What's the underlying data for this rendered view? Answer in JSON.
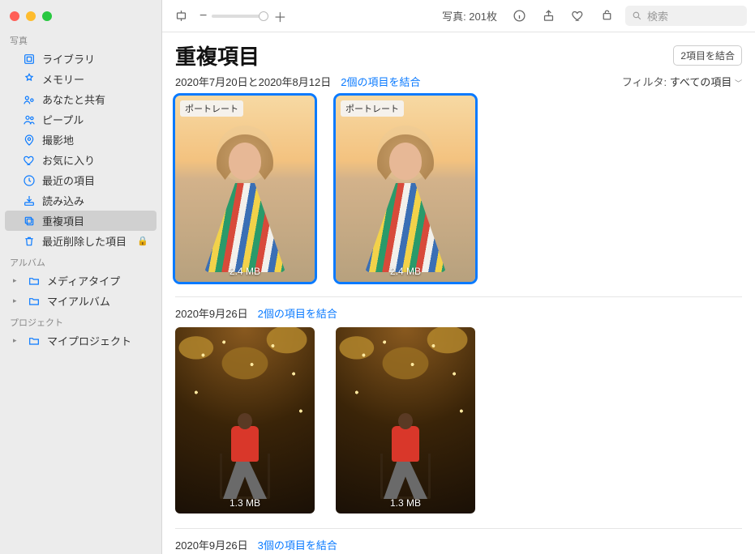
{
  "toolbar": {
    "photo_count": "写真: 201枚",
    "search_placeholder": "検索"
  },
  "sidebar": {
    "sections": [
      {
        "label": "写真",
        "items": [
          {
            "icon": "library",
            "label": "ライブラリ"
          },
          {
            "icon": "memories",
            "label": "メモリー"
          },
          {
            "icon": "shared",
            "label": "あなたと共有"
          },
          {
            "icon": "people",
            "label": "ピープル"
          },
          {
            "icon": "places",
            "label": "撮影地"
          },
          {
            "icon": "favorite",
            "label": "お気に入り"
          },
          {
            "icon": "recent",
            "label": "最近の項目"
          },
          {
            "icon": "import",
            "label": "読み込み"
          },
          {
            "icon": "duplicate",
            "label": "重複項目",
            "selected": true
          },
          {
            "icon": "trash",
            "label": "最近削除した項目",
            "locked": true
          }
        ]
      },
      {
        "label": "アルバム",
        "items": [
          {
            "icon": "folder",
            "label": "メディアタイプ",
            "disclosable": true
          },
          {
            "icon": "folder",
            "label": "マイアルバム",
            "disclosable": true
          }
        ]
      },
      {
        "label": "プロジェクト",
        "items": [
          {
            "icon": "folder",
            "label": "マイプロジェクト",
            "disclosable": true
          }
        ]
      }
    ]
  },
  "page": {
    "title": "重複項目",
    "merge_all_button": "2項目を結合",
    "filter_label": "フィルタ:",
    "filter_value": "すべての項目"
  },
  "groups": [
    {
      "date_range": "2020年7月20日と2020年8月12日",
      "merge_link": "2個の項目を結合",
      "thumbs": [
        {
          "scene": "scene1",
          "badge": "ポートレート",
          "size": "2.4 MB",
          "selected": true
        },
        {
          "scene": "scene1",
          "badge": "ポートレート",
          "size": "2.4 MB",
          "selected": true
        }
      ]
    },
    {
      "date_range": "2020年9月26日",
      "merge_link": "2個の項目を結合",
      "thumbs": [
        {
          "scene": "scene2",
          "size": "1.3 MB"
        },
        {
          "scene": "scene2",
          "size": "1.3 MB"
        }
      ]
    },
    {
      "date_range": "2020年9月26日",
      "merge_link": "3個の項目を結合",
      "thumbs": []
    }
  ]
}
